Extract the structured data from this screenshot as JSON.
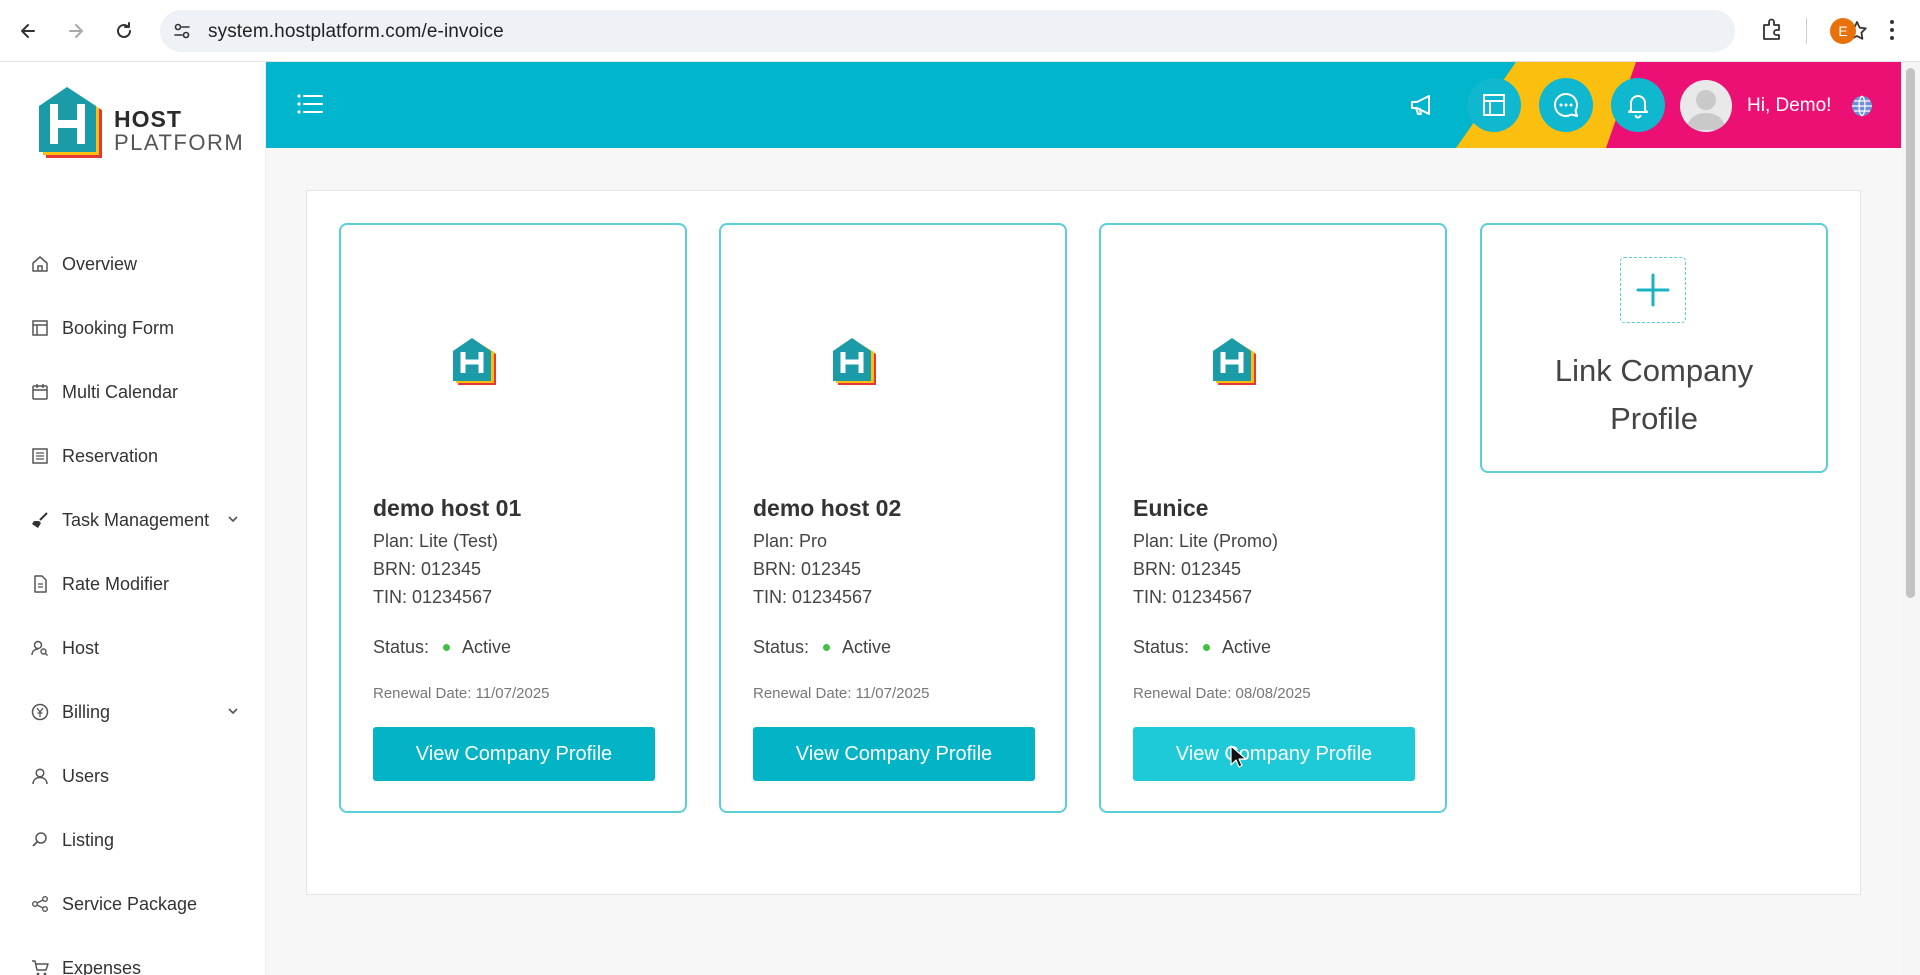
{
  "browser": {
    "url": "system.hostplatform.com/e-invoice",
    "profile_initial": "E"
  },
  "brand": {
    "name_line1": "HOST",
    "name_line2": "PLATFORM",
    "logo_letter": "H",
    "colors": {
      "teal": "#00b5cc",
      "yellow": "#fbbf10",
      "pink": "#ec1075"
    }
  },
  "sidebar": {
    "items": [
      {
        "label": "Overview",
        "icon": "home-icon"
      },
      {
        "label": "Booking Form",
        "icon": "layout-icon"
      },
      {
        "label": "Multi Calendar",
        "icon": "calendar-icon"
      },
      {
        "label": "Reservation",
        "icon": "list-icon"
      },
      {
        "label": "Task Management",
        "icon": "broom-icon",
        "expandable": true
      },
      {
        "label": "Rate Modifier",
        "icon": "document-icon"
      },
      {
        "label": "Host",
        "icon": "person-search-icon"
      },
      {
        "label": "Billing",
        "icon": "currency-icon",
        "expandable": true
      },
      {
        "label": "Users",
        "icon": "user-icon"
      },
      {
        "label": "Listing",
        "icon": "search-icon"
      },
      {
        "label": "Service Package",
        "icon": "share-icon"
      },
      {
        "label": "Expenses",
        "icon": "cart-icon"
      }
    ]
  },
  "header": {
    "greeting": "Hi, Demo!"
  },
  "cards": [
    {
      "name": "demo host 01",
      "plan": "Plan: Lite (Test)",
      "brn": "BRN: 012345",
      "tin": "TIN: 01234567",
      "status_label": "Status:",
      "status_value": "Active",
      "renewal": "Renewal Date: 11/07/2025",
      "button": "View Company Profile"
    },
    {
      "name": "demo host 02",
      "plan": "Plan: Pro",
      "brn": "BRN: 012345",
      "tin": "TIN: 01234567",
      "status_label": "Status:",
      "status_value": "Active",
      "renewal": "Renewal Date: 11/07/2025",
      "button": "View Company Profile"
    },
    {
      "name": "Eunice",
      "plan": "Plan: Lite (Promo)",
      "brn": "BRN: 012345",
      "tin": "TIN: 01234567",
      "status_label": "Status:",
      "status_value": "Active",
      "renewal": "Renewal Date: 08/08/2025",
      "button": "View Company Profile"
    }
  ],
  "link_card": {
    "line1": "Link Company",
    "line2": "Profile"
  }
}
